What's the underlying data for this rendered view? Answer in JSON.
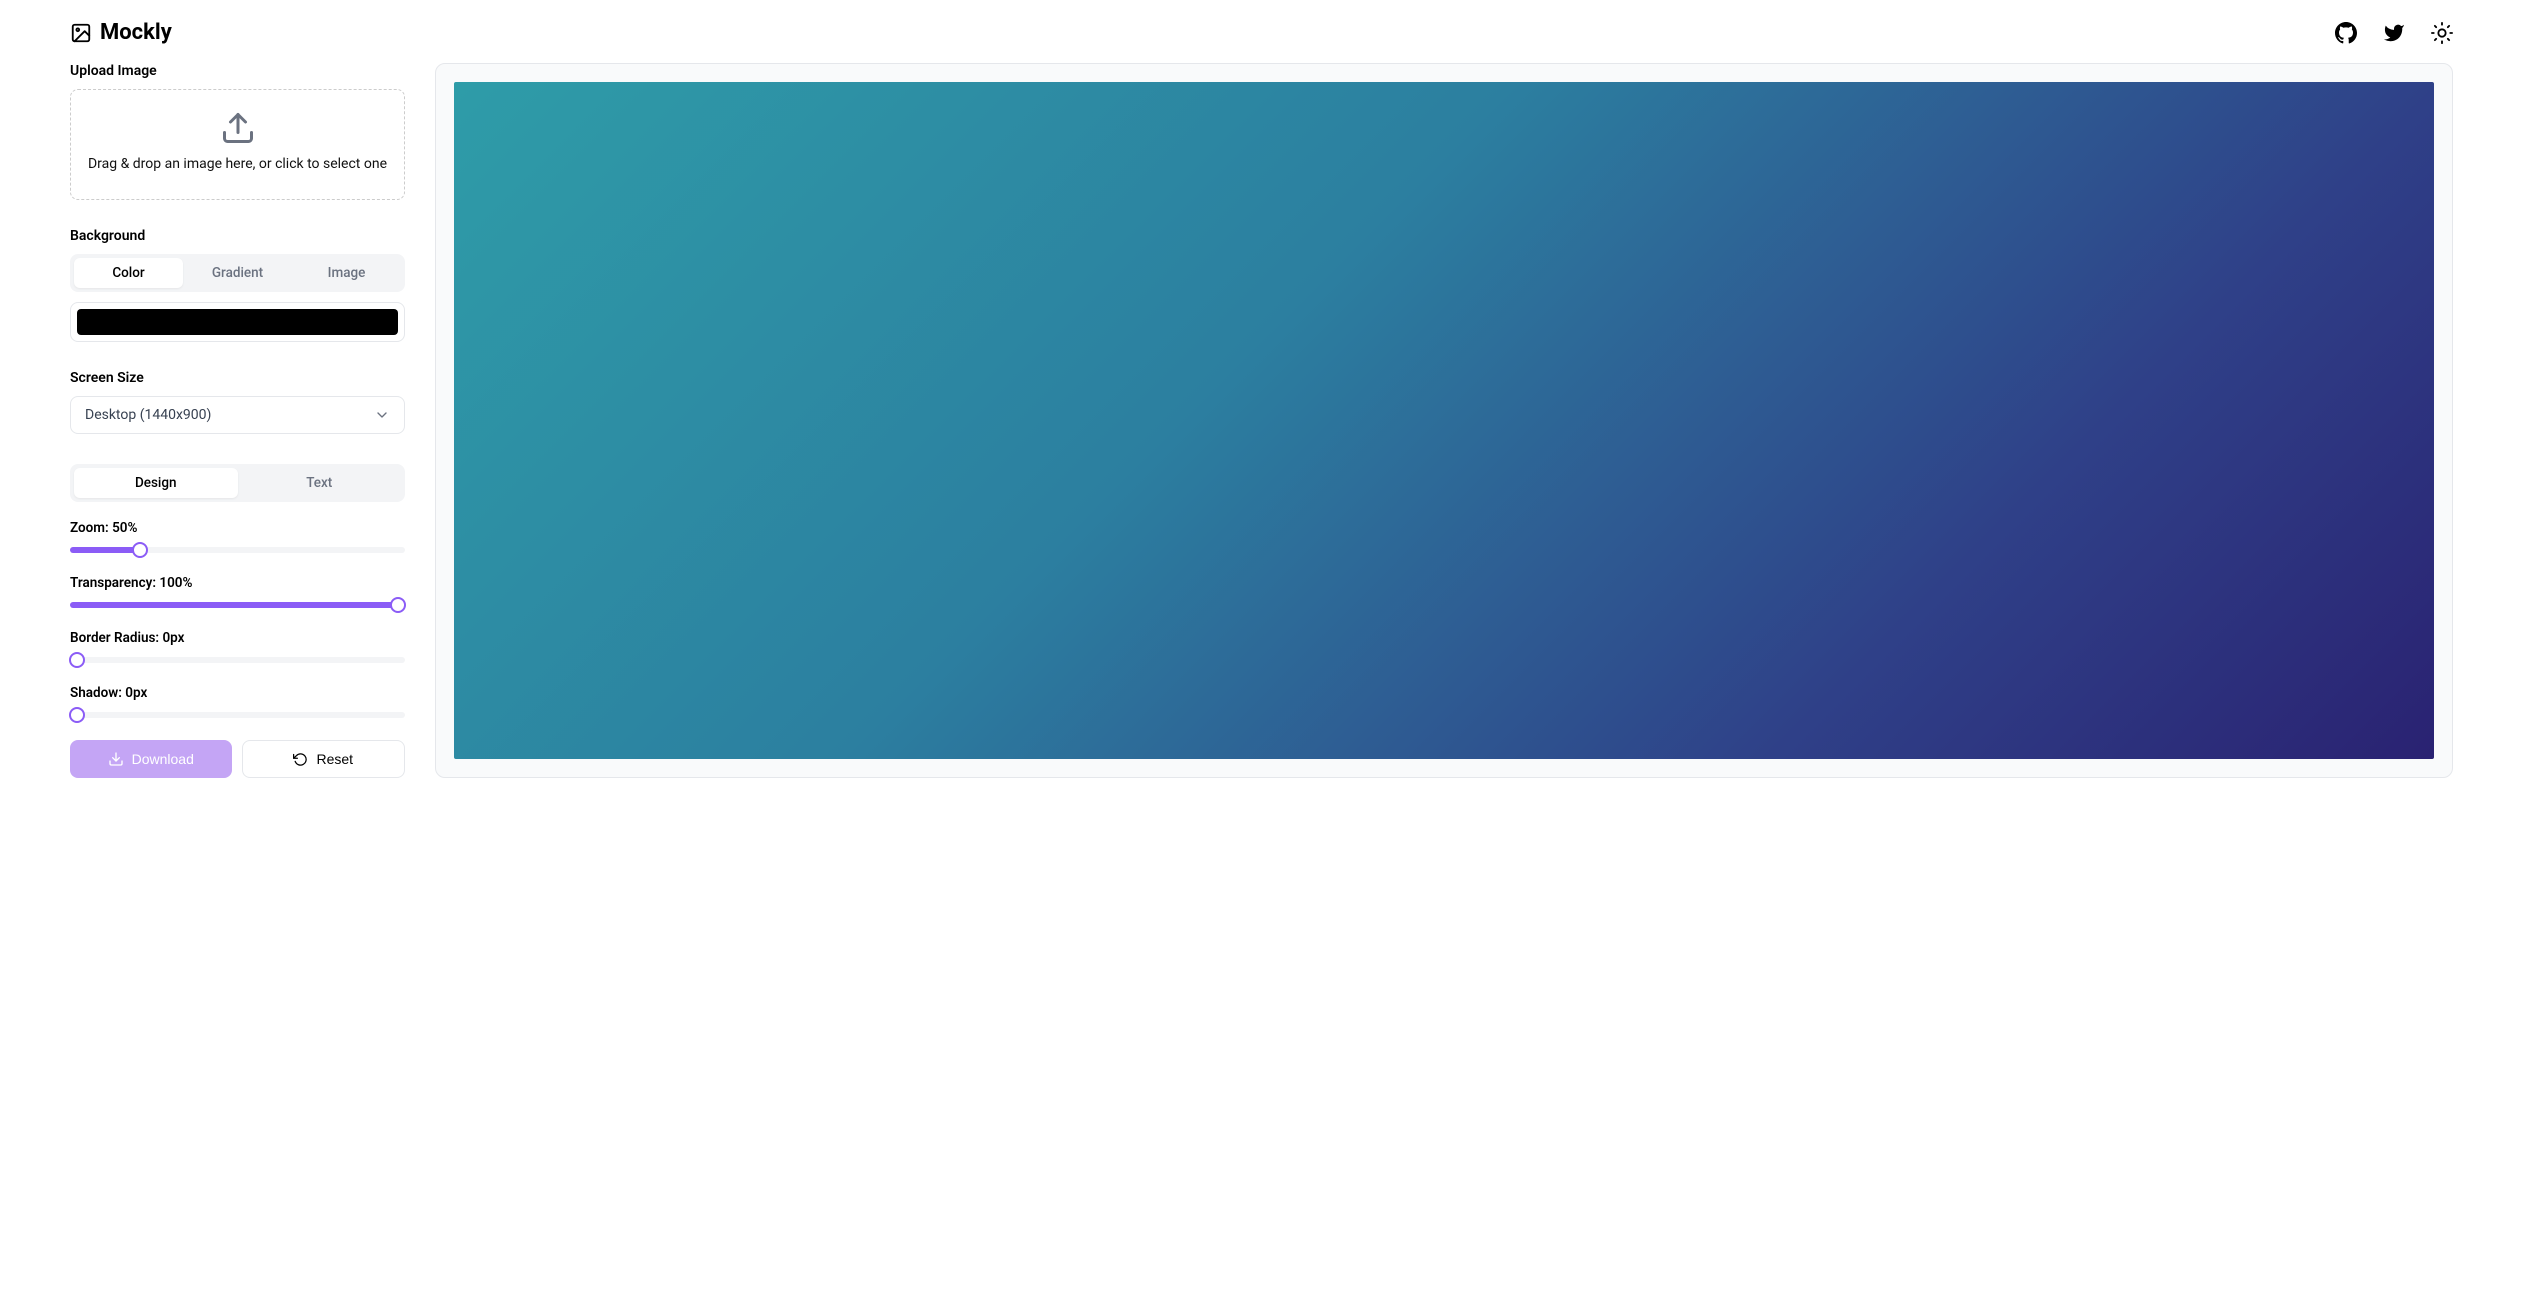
{
  "brand": "Mockly",
  "sidebar": {
    "upload": {
      "label": "Upload Image",
      "hint": "Drag & drop an image here, or click to select one"
    },
    "background": {
      "label": "Background",
      "tabs": [
        "Color",
        "Gradient",
        "Image"
      ],
      "active_index": 0,
      "color_value": "#000000"
    },
    "screen_size": {
      "label": "Screen Size",
      "selected": "Desktop (1440x900)"
    },
    "panel_tabs": {
      "items": [
        "Design",
        "Text"
      ],
      "active_index": 0
    },
    "sliders": {
      "zoom": {
        "label": "Zoom: 50%",
        "percent": 21
      },
      "transparency": {
        "label": "Transparency: 100%",
        "percent": 100
      },
      "border_radius": {
        "label": "Border Radius: 0px",
        "percent": 0
      },
      "shadow": {
        "label": "Shadow: 0px",
        "percent": 0
      }
    },
    "actions": {
      "download": "Download",
      "reset": "Reset"
    }
  },
  "canvas": {
    "gradient_from": "#2e9ca8",
    "gradient_to": "#2a2272"
  }
}
